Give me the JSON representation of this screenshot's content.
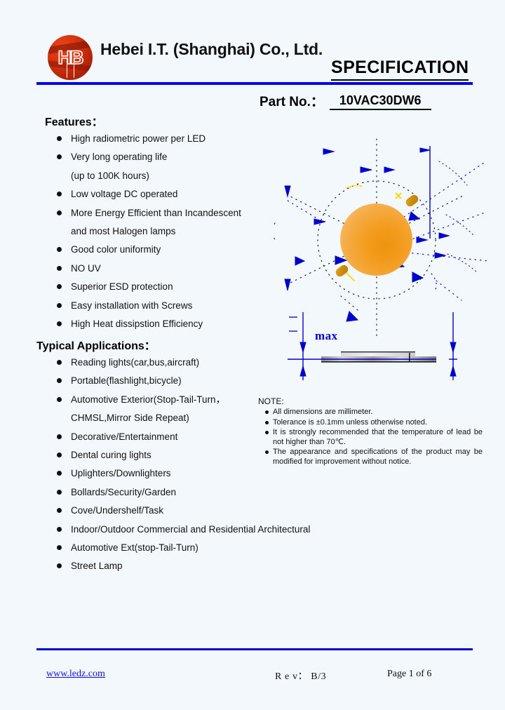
{
  "page": {
    "background_color": "#f3f8fc",
    "accent_blue": "#0000ee",
    "logo_red": "#d8340f",
    "led_orange": "#f39b1c"
  },
  "header": {
    "logo_text": "HB",
    "company_name": "Hebei I.T. (Shanghai) Co., Ltd.",
    "spec_title": "SPECIFICATION",
    "part_label": "Part No.：",
    "part_number": "10VAC30DW6"
  },
  "features": {
    "heading": "Features：",
    "items": [
      {
        "text": "High radiometric power per LED",
        "bullet": true
      },
      {
        "text": "Very long operating life",
        "bullet": true
      },
      {
        "text": "(up to 100K hours)",
        "bullet": false
      },
      {
        "text": "Low voltage DC operated",
        "bullet": true
      },
      {
        "text": "More Energy Efficient than Incandescent",
        "bullet": true
      },
      {
        "text": "and most Halogen lamps",
        "bullet": false
      },
      {
        "text": "Good color uniformity",
        "bullet": true
      },
      {
        "text": "NO UV",
        "bullet": true
      },
      {
        "text": "Superior ESD protection",
        "bullet": true
      },
      {
        "text": "Easy installation with Screws",
        "bullet": true
      },
      {
        "text": "High Heat dissipstion Efficiency",
        "bullet": true
      }
    ]
  },
  "applications": {
    "heading": "Typical Applications：",
    "items": [
      {
        "text": "Reading lights(car,bus,aircraft)",
        "bullet": true
      },
      {
        "text": "Portable(flashlight,bicycle)",
        "bullet": true
      },
      {
        "text": "Automotive Exterior(Stop-Tail-Turn，",
        "bullet": true
      },
      {
        "text": "CHMSL,Mirror Side Repeat)",
        "bullet": false
      },
      {
        "text": "Decorative/Entertainment",
        "bullet": true
      },
      {
        "text": "Dental curing lights",
        "bullet": true
      },
      {
        "text": "Uplighters/Downlighters",
        "bullet": true
      },
      {
        "text": "Bollards/Security/Garden",
        "bullet": true
      },
      {
        "text": "Cove/Undershelf/Task",
        "bullet": true
      },
      {
        "text": "Indoor/Outdoor Commercial and Residential Architectural",
        "bullet": true
      },
      {
        "text": "Automotive Ext(stop-Tail-Turn)",
        "bullet": true
      },
      {
        "text": "Street Lamp",
        "bullet": true
      }
    ]
  },
  "drawing": {
    "max_label": "max",
    "led_color": "#f39b1c",
    "dimension_line_color": "#0000cc",
    "gold_pad_color": "#c98a0a"
  },
  "note": {
    "title": "NOTE:",
    "items": [
      "All dimensions are millimeter.",
      "Tolerance is ±0.1mm unless otherwise noted.",
      "It is strongly recommended that the temperature of lead be not higher than 70℃.",
      "The appearance and specifications of the product may be modified for improvement without notice."
    ]
  },
  "footer": {
    "url": "www.ledz.com",
    "revision": "R e v： B/3",
    "page": "Page 1 of 6"
  }
}
